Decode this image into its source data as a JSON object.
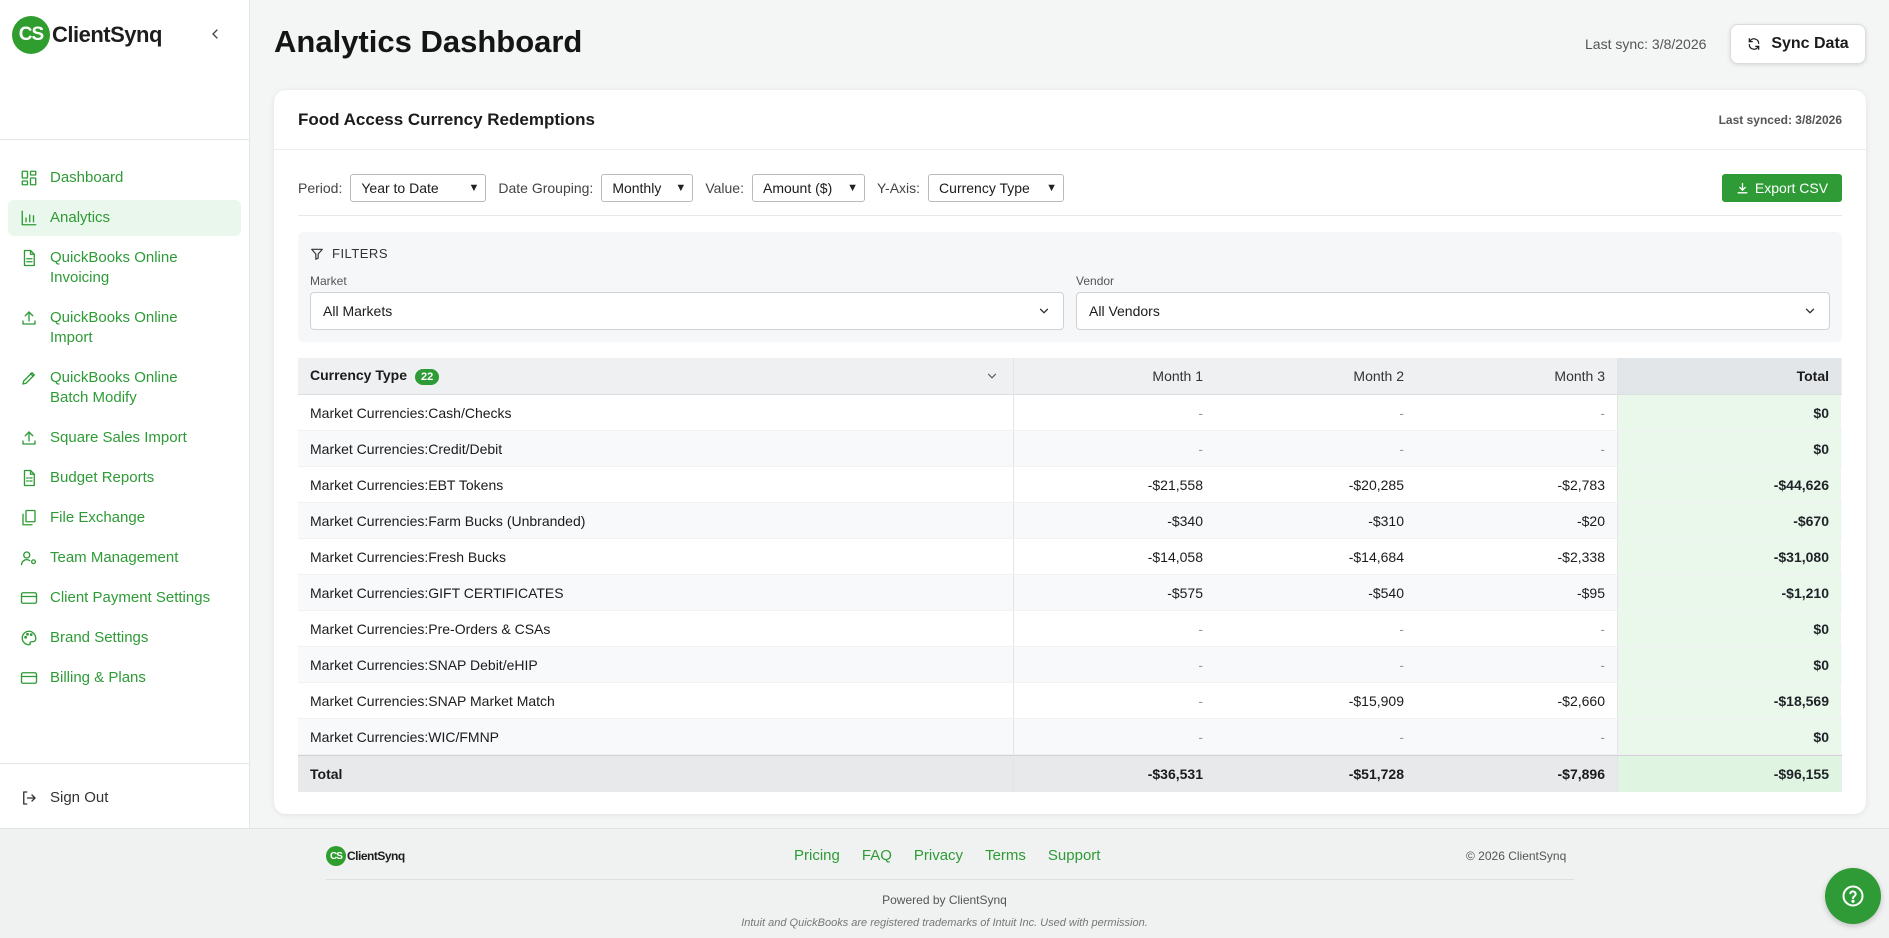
{
  "brand": {
    "badge": "CS",
    "name": "ClientSynq"
  },
  "sidebar": {
    "items": [
      {
        "label": "Dashboard",
        "icon": "dashboard-icon"
      },
      {
        "label": "Analytics",
        "icon": "bar-chart-icon",
        "active": true
      },
      {
        "label": "QuickBooks Online Invoicing",
        "icon": "document-icon"
      },
      {
        "label": "QuickBooks Online Import",
        "icon": "upload-icon"
      },
      {
        "label": "QuickBooks Online Batch Modify",
        "icon": "pencil-icon"
      },
      {
        "label": "Square Sales Import",
        "icon": "upload-icon"
      },
      {
        "label": "Budget Reports",
        "icon": "report-icon"
      },
      {
        "label": "File Exchange",
        "icon": "files-icon"
      },
      {
        "label": "Team Management",
        "icon": "user-gear-icon"
      },
      {
        "label": "Client Payment Settings",
        "icon": "card-icon"
      },
      {
        "label": "Brand Settings",
        "icon": "palette-icon"
      },
      {
        "label": "Billing & Plans",
        "icon": "card-icon"
      }
    ],
    "signout_label": "Sign Out"
  },
  "header": {
    "title": "Analytics Dashboard",
    "last_sync": "Last sync: 3/8/2026",
    "sync_button": "Sync Data"
  },
  "card": {
    "title": "Food Access Currency Redemptions",
    "last_synced": "Last synced: 3/8/2026"
  },
  "controls": {
    "period_label": "Period:",
    "period_value": "Year to Date",
    "grouping_label": "Date Grouping:",
    "grouping_value": "Monthly",
    "value_label": "Value:",
    "value_value": "Amount ($)",
    "yaxis_label": "Y-Axis:",
    "yaxis_value": "Currency Type",
    "export_label": "Export CSV"
  },
  "filters": {
    "heading": "FILTERS",
    "market_label": "Market",
    "market_value": "All Markets",
    "vendor_label": "Vendor",
    "vendor_value": "All Vendors"
  },
  "table": {
    "header": {
      "first": "Currency Type",
      "count": "22",
      "m1": "Month 1",
      "m2": "Month 2",
      "m3": "Month 3",
      "total": "Total"
    },
    "rows": [
      {
        "name": "Market Currencies:Cash/Checks",
        "m1": "-",
        "m2": "-",
        "m3": "-",
        "total": "$0"
      },
      {
        "name": "Market Currencies:Credit/Debit",
        "m1": "-",
        "m2": "-",
        "m3": "-",
        "total": "$0"
      },
      {
        "name": "Market Currencies:EBT Tokens",
        "m1": "-$21,558",
        "m2": "-$20,285",
        "m3": "-$2,783",
        "total": "-$44,626"
      },
      {
        "name": "Market Currencies:Farm Bucks (Unbranded)",
        "m1": "-$340",
        "m2": "-$310",
        "m3": "-$20",
        "total": "-$670"
      },
      {
        "name": "Market Currencies:Fresh Bucks",
        "m1": "-$14,058",
        "m2": "-$14,684",
        "m3": "-$2,338",
        "total": "-$31,080"
      },
      {
        "name": "Market Currencies:GIFT CERTIFICATES",
        "m1": "-$575",
        "m2": "-$540",
        "m3": "-$95",
        "total": "-$1,210"
      },
      {
        "name": "Market Currencies:Pre-Orders & CSAs",
        "m1": "-",
        "m2": "-",
        "m3": "-",
        "total": "$0"
      },
      {
        "name": "Market Currencies:SNAP Debit/eHIP",
        "m1": "-",
        "m2": "-",
        "m3": "-",
        "total": "$0"
      },
      {
        "name": "Market Currencies:SNAP Market Match",
        "m1": "-",
        "m2": "-$15,909",
        "m3": "-$2,660",
        "total": "-$18,569"
      },
      {
        "name": "Market Currencies:WIC/FMNP",
        "m1": "-",
        "m2": "-",
        "m3": "-",
        "total": "$0"
      }
    ],
    "totals": {
      "name": "Total",
      "m1": "-$36,531",
      "m2": "-$51,728",
      "m3": "-$7,896",
      "total": "-$96,155"
    }
  },
  "footer": {
    "links": [
      "Pricing",
      "FAQ",
      "Privacy",
      "Terms",
      "Support"
    ],
    "copyright": "© 2026 ClientSynq",
    "powered": "Powered by ClientSynq",
    "trademark": "Intuit and QuickBooks are registered trademarks of Intuit Inc. Used with permission."
  },
  "colors": {
    "accent": "#2e9b36",
    "active_bg": "#eaf7ec",
    "total_col_bg": "#eaf8ec"
  }
}
